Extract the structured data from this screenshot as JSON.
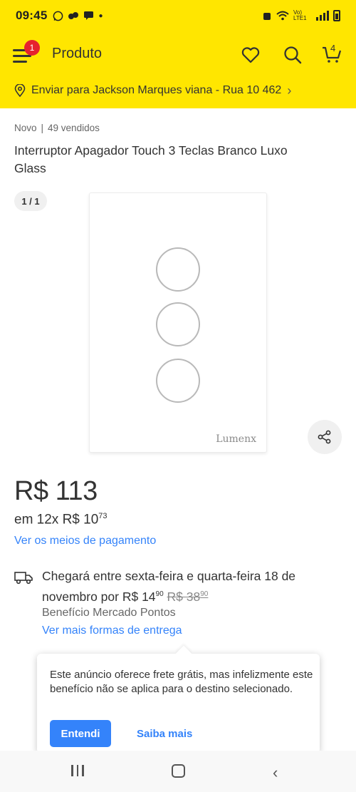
{
  "status_bar": {
    "time": "09:45",
    "network": "Vo) LTE1"
  },
  "header": {
    "title": "Produto",
    "menu_badge": "1",
    "cart_count": "4",
    "ship_to": "Enviar para Jackson Marques viana - Rua 10 462"
  },
  "product": {
    "condition": "Novo",
    "separator": "|",
    "sold": "49 vendidos",
    "title": "Interruptor Apagador Touch 3 Teclas Branco Luxo Glass",
    "image_pager": "1 / 1",
    "brand": "Lumenx",
    "price": "R$ 113",
    "installments_prefix": "em 12x R$ 10",
    "installments_cents": "73",
    "payment_link": "Ver os meios de pagamento"
  },
  "delivery": {
    "text_main": "Chegará entre sexta-feira e quarta-feira 18 de novembro por R$ 14",
    "price_cents": "90",
    "old_price": "R$ 38",
    "old_price_cents": "90",
    "benefit": "Benefício Mercado Pontos",
    "more_link": "Ver mais formas de entrega"
  },
  "tooltip": {
    "text": "Este anúncio oferece frete grátis, mas infelizmente este benefício não se aplica para o destino selecionado.",
    "primary_button": "Entendi",
    "secondary_button": "Saiba mais"
  },
  "colors": {
    "header_bg": "#ffe600",
    "link": "#3483fa",
    "badge": "#e6222e"
  }
}
